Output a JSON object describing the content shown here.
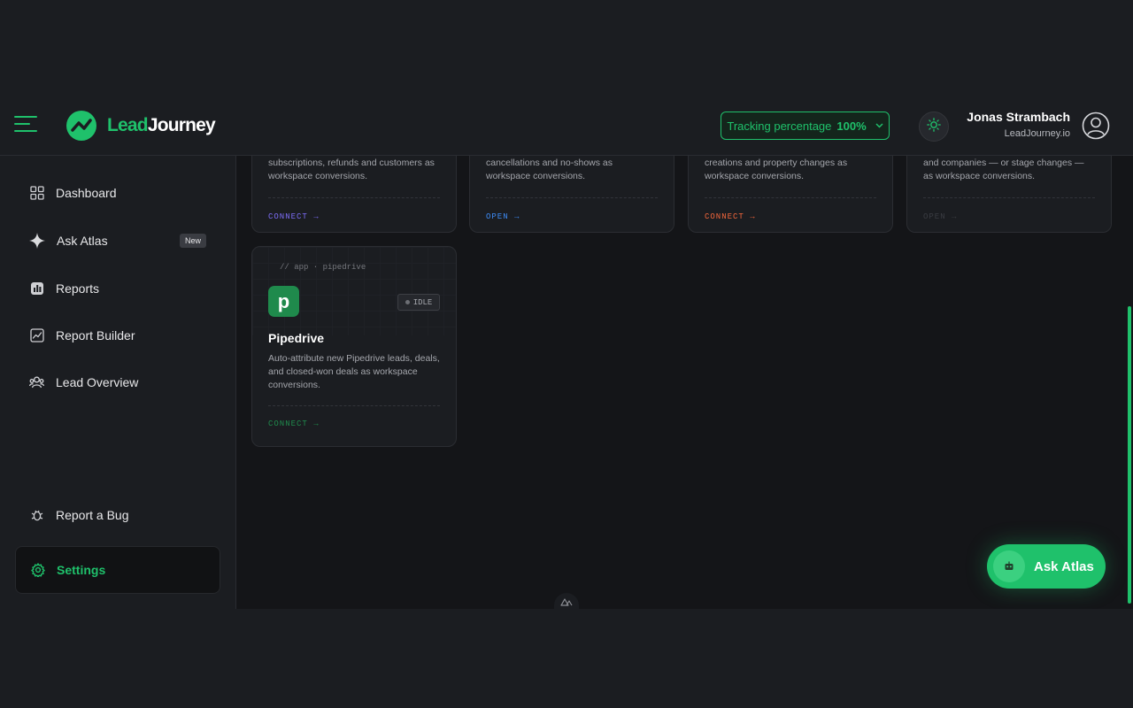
{
  "header": {
    "brand_lead": "Lead",
    "brand_journey": "Journey",
    "tracking_label": "Tracking percentage",
    "tracking_value": "100%",
    "user_name": "Jonas Strambach",
    "user_domain": "LeadJourney.io"
  },
  "sidebar": {
    "items": [
      {
        "label": "Dashboard",
        "icon": "grid-icon"
      },
      {
        "label": "Ask Atlas",
        "icon": "sparkle-icon",
        "badge": "New"
      },
      {
        "label": "Reports",
        "icon": "bar-chart-icon"
      },
      {
        "label": "Report Builder",
        "icon": "line-chart-icon"
      },
      {
        "label": "Lead Overview",
        "icon": "users-icon"
      }
    ],
    "bottom": [
      {
        "label": "Report a Bug",
        "icon": "bug-icon"
      },
      {
        "label": "Settings",
        "icon": "gear-icon"
      }
    ]
  },
  "cards_top": [
    {
      "desc": "subscriptions, refunds and customers as workspace conversions.",
      "action": "CONNECT",
      "color": "#7c6cf5"
    },
    {
      "desc": "cancellations and no-shows as workspace conversions.",
      "action": "OPEN",
      "color": "#3d8bf5"
    },
    {
      "desc": "creations and property changes as workspace conversions.",
      "action": "CONNECT",
      "color": "#f2663b"
    },
    {
      "desc": "and companies — or stage changes — as workspace conversions.",
      "action": "OPEN",
      "color": "#3a3c42"
    }
  ],
  "pipedrive": {
    "path": "// app · pipedrive",
    "status": "IDLE",
    "title": "Pipedrive",
    "letter": "p",
    "desc": "Auto-attribute new Pipedrive leads, deals, and closed-won deals as workspace conversions.",
    "action": "CONNECT",
    "color": "#1f8a4c"
  },
  "fab": {
    "label": "Ask Atlas"
  },
  "colors": {
    "accent": "#1fc16b",
    "background": "#141518",
    "panel": "#1b1d21"
  }
}
